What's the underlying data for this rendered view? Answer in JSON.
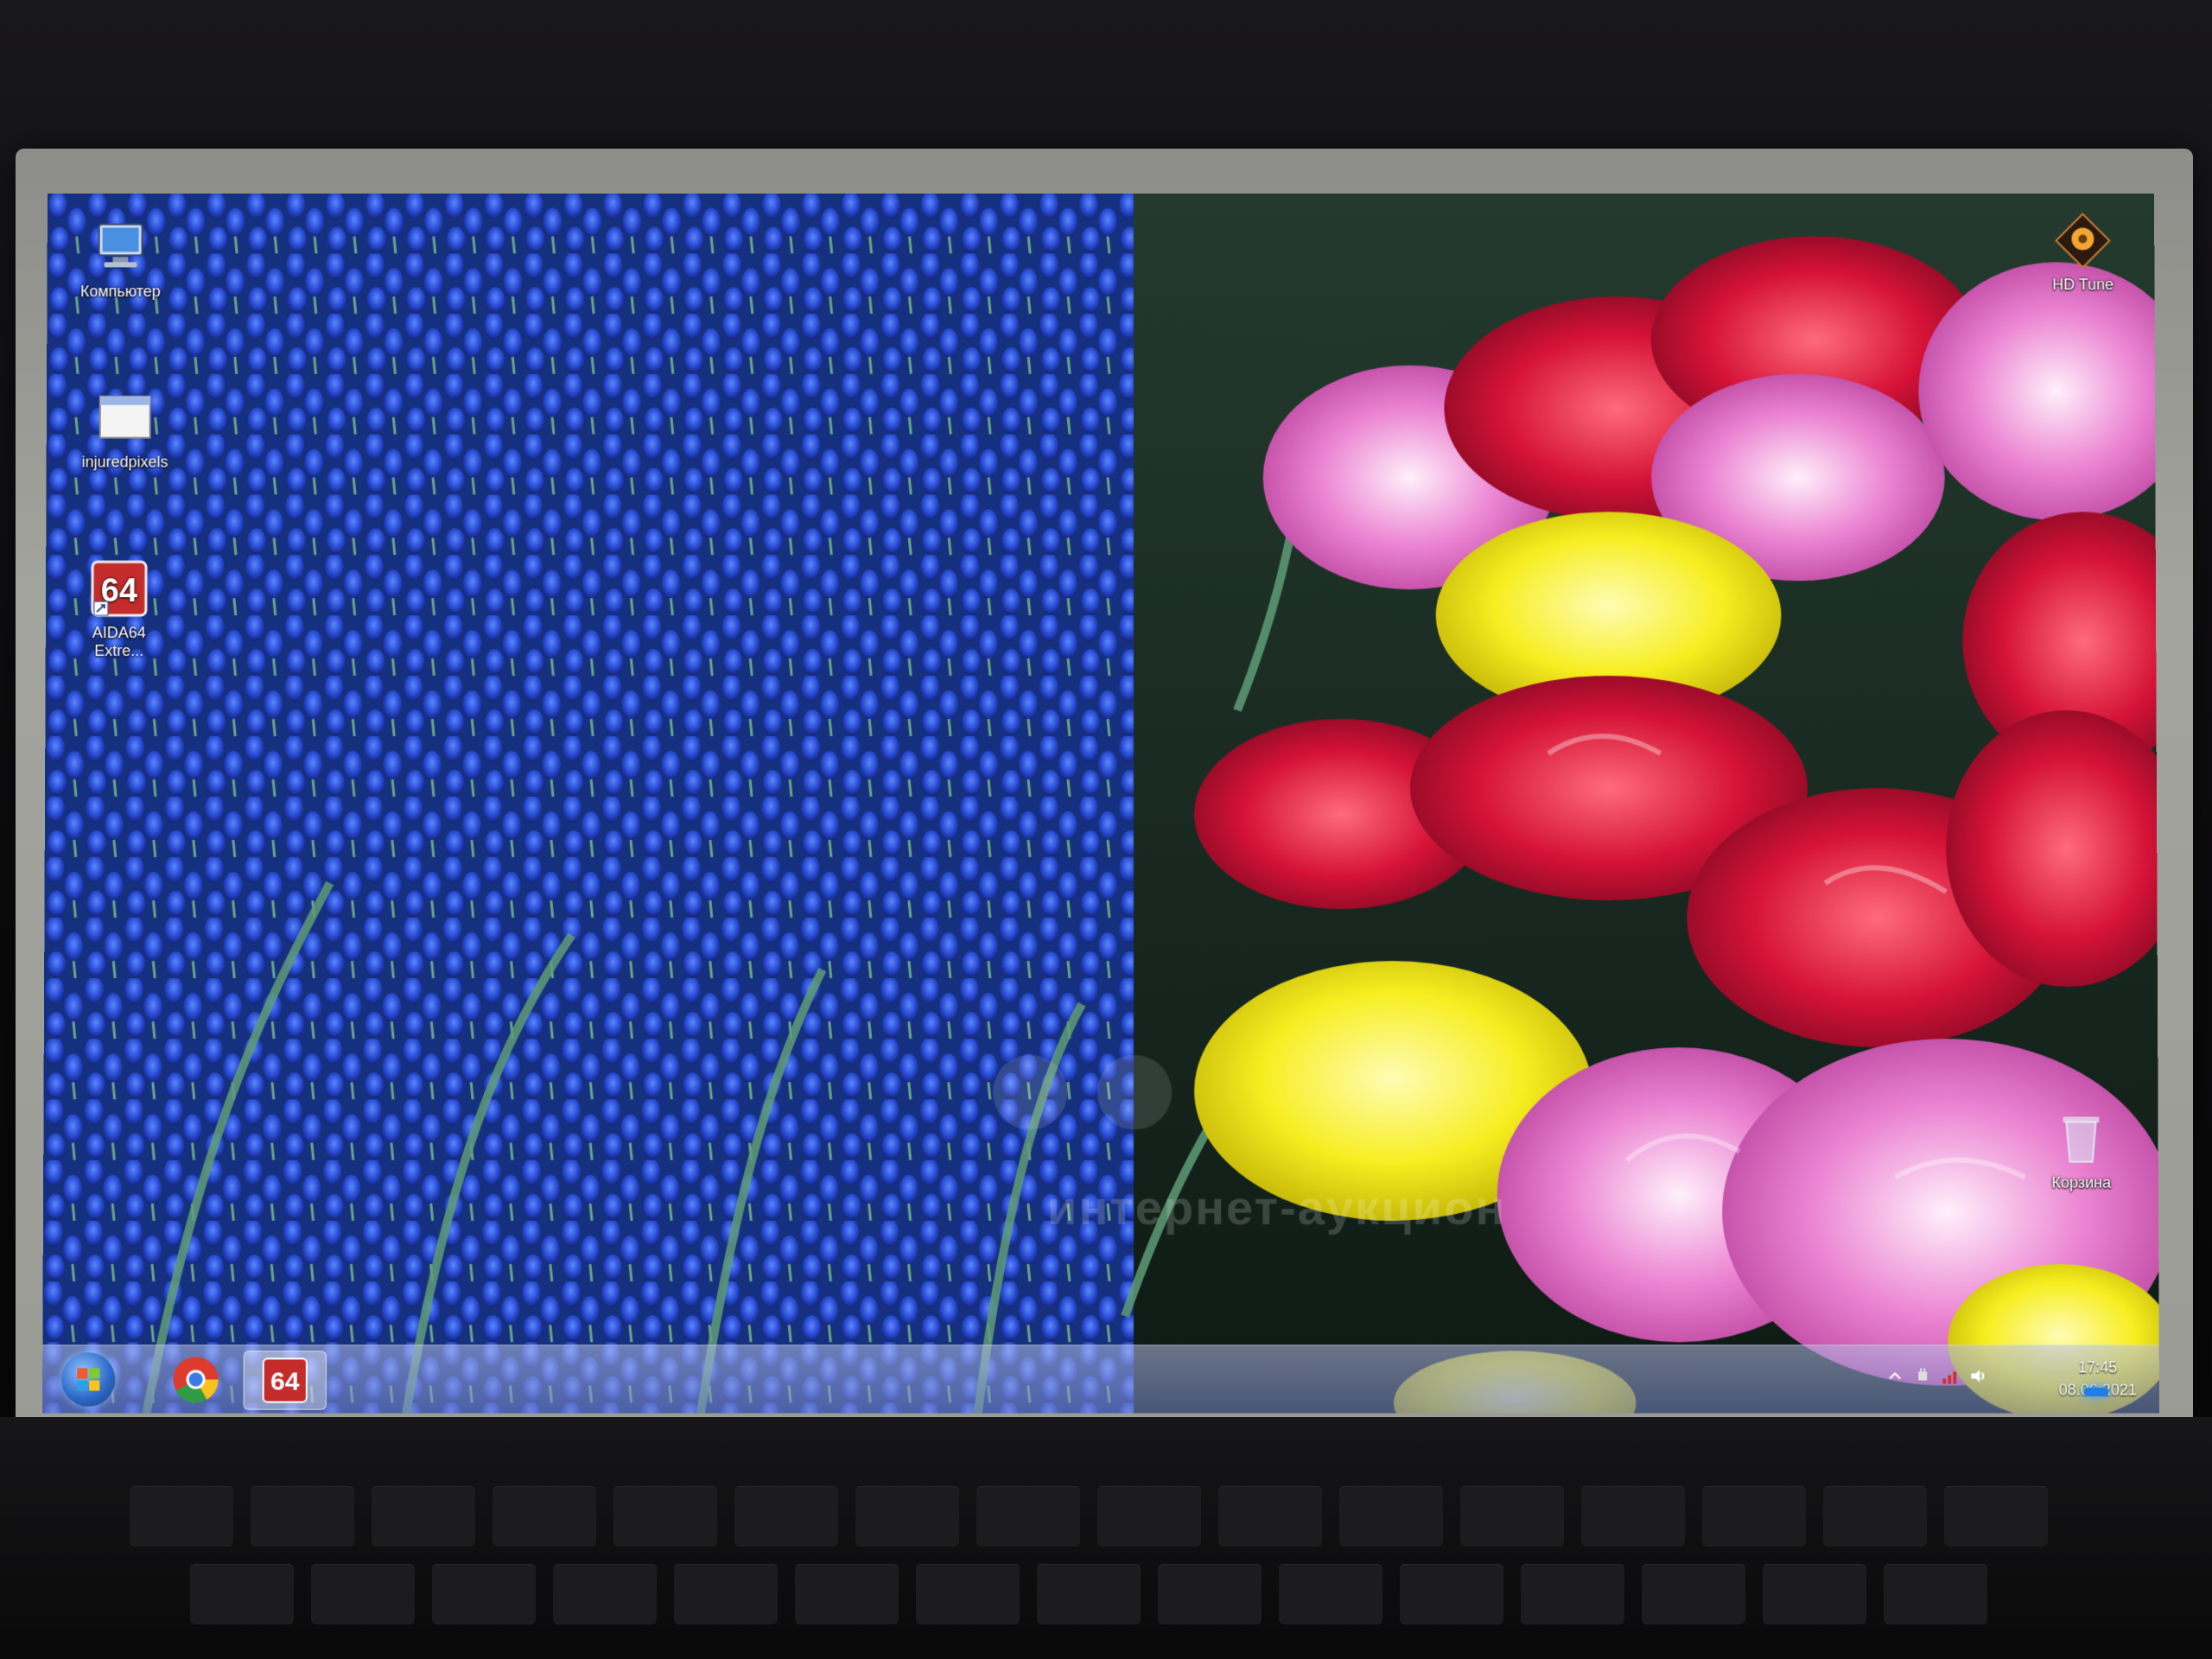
{
  "desktop": {
    "icons": [
      {
        "label": "Компьютер",
        "icon": "computer-icon"
      },
      {
        "label": "injuredpixels",
        "icon": "window-app-icon"
      },
      {
        "label": "AIDA64 Extre...",
        "icon": "aida64-icon",
        "badge": "64"
      },
      {
        "label": "HD Tune",
        "icon": "hdtune-icon"
      },
      {
        "label": "Корзина",
        "icon": "recycle-bin-icon"
      }
    ]
  },
  "taskbar": {
    "start": "windows-start-icon",
    "pinned": [
      {
        "name": "chrome-icon"
      },
      {
        "name": "aida64-taskbar-icon",
        "badge": "64"
      }
    ],
    "tray": {
      "time": "17:45",
      "date": "08.06.2021"
    }
  },
  "watermark": {
    "text": "интернет-аукцион"
  },
  "colors": {
    "muscari_blue": "#2a55d8",
    "tulip_red": "#d21237",
    "tulip_pink": "#e56bc2",
    "tulip_yellow": "#f2ec1f",
    "leaf_green": "#4c8a5a"
  }
}
